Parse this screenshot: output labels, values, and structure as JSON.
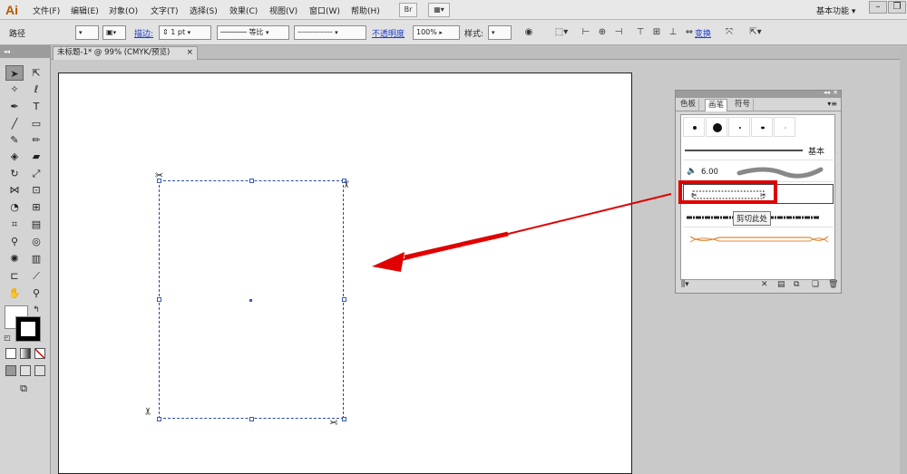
{
  "app": {
    "logo": "Ai"
  },
  "menu": {
    "items": [
      "文件(F)",
      "编辑(E)",
      "对象(O)",
      "文字(T)",
      "选择(S)",
      "效果(C)",
      "视图(V)",
      "窗口(W)",
      "帮助(H)"
    ],
    "bridge_label": "Br",
    "workspace": "基本功能 ▾"
  },
  "control": {
    "selection_label": "路径",
    "stroke_label": "描边:",
    "stroke_weight": "1 pt",
    "profile_label": "等比",
    "opacity_label": "不透明度",
    "opacity_value": "100%",
    "style_label": "样式:",
    "transform_label": "变换"
  },
  "document": {
    "tab_title": "未标题-1* @ 99% (CMYK/预览)",
    "tab_close": "×"
  },
  "panel": {
    "tabs": [
      "色板",
      "画笔",
      "符号"
    ],
    "active_tab": "画笔",
    "brushes": {
      "basic_label": "基本",
      "size_label": "6.00"
    },
    "tooltip": "剪切此处"
  },
  "colors": {
    "highlight": "#e00000",
    "arrow": "#e00000",
    "path_stroke": "#2a4aa0"
  }
}
